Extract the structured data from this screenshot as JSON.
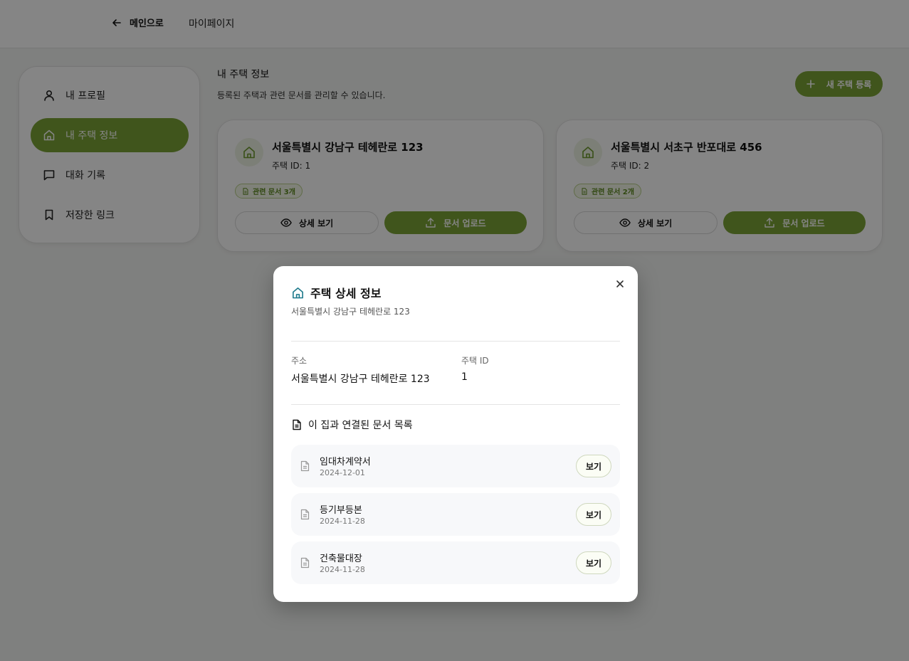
{
  "header": {
    "back_label": "메인으로",
    "title": "마이페이지"
  },
  "sidebar": {
    "items": [
      {
        "label": "내 프로필",
        "icon": "user-icon"
      },
      {
        "label": "내 주택 정보",
        "icon": "home-icon",
        "active": true
      },
      {
        "label": "대화 기록",
        "icon": "chat-icon"
      },
      {
        "label": "저장한 링크",
        "icon": "bookmark-icon"
      }
    ]
  },
  "main": {
    "title": "내 주택 정보",
    "subtitle": "등록된 주택과 관련 문서를 관리할 수 있습니다.",
    "new_button": "새 주택 등록"
  },
  "houses": [
    {
      "address": "서울특별시 강남구 테헤란로 123",
      "id_text": "주택 ID: 1",
      "badge": "관련 문서 3개",
      "detail_label": "상세 보기",
      "upload_label": "문서 업로드"
    },
    {
      "address": "서울특별시 서초구 반포대로 456",
      "id_text": "주택 ID: 2",
      "badge": "관련 문서 2개",
      "detail_label": "상세 보기",
      "upload_label": "문서 업로드"
    }
  ],
  "modal": {
    "title": "주택 상세 정보",
    "subtitle": "서울특별시 강남구 테헤란로 123",
    "address_label": "주소",
    "address_value": "서울특별시 강남구 테헤란로 123",
    "id_label": "주택 ID",
    "id_value": "1",
    "docs_title": "이 집과 연결된 문서 목록",
    "documents": [
      {
        "name": "임대차계약서",
        "date": "2024-12-01",
        "action": "보기"
      },
      {
        "name": "등기부등본",
        "date": "2024-11-28",
        "action": "보기"
      },
      {
        "name": "건축물대장",
        "date": "2024-11-28",
        "action": "보기"
      }
    ]
  },
  "colors": {
    "accent": "#7ba336",
    "modal_icon": "#1f7a8c",
    "overlay": "rgba(0,0,0,0.48)"
  }
}
